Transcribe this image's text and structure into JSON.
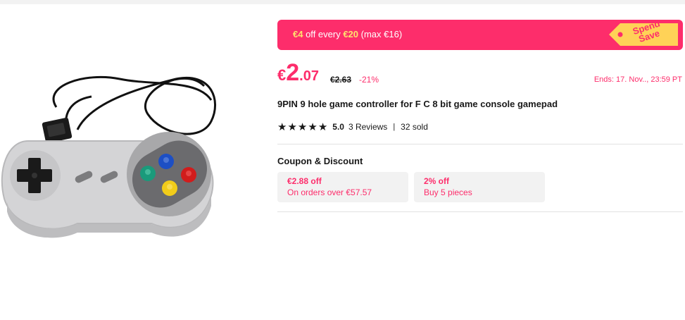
{
  "promo": {
    "text_part1": "€4",
    "text_part2": " off every ",
    "text_part3": "€20",
    "text_part4": " (max €16)",
    "tag_line1": "Spend",
    "tag_line2": "Save"
  },
  "price": {
    "currency": "€",
    "integer": "2",
    "decimal": ".07",
    "original": "€2.63",
    "discount": "-21%",
    "ends": "Ends: 17. Nov.., 23:59 PT"
  },
  "product": {
    "title": "9PIN 9 hole game controller for F C 8 bit game console gamepad",
    "rating_score": "5.0",
    "reviews": "3 Reviews",
    "separator": "|",
    "sold": "32 sold",
    "stars": 5
  },
  "coupons": {
    "section_title": "Coupon & Discount",
    "items": [
      {
        "amount": "€2.88 off",
        "condition": "On orders over €57.57"
      },
      {
        "amount": "2% off",
        "condition": "Buy 5 pieces"
      }
    ]
  },
  "colors": {
    "accent": "#fd2d6b",
    "highlight": "#ffe26e",
    "tag": "#ffd257",
    "coupon_bg": "#f2f2f2"
  }
}
